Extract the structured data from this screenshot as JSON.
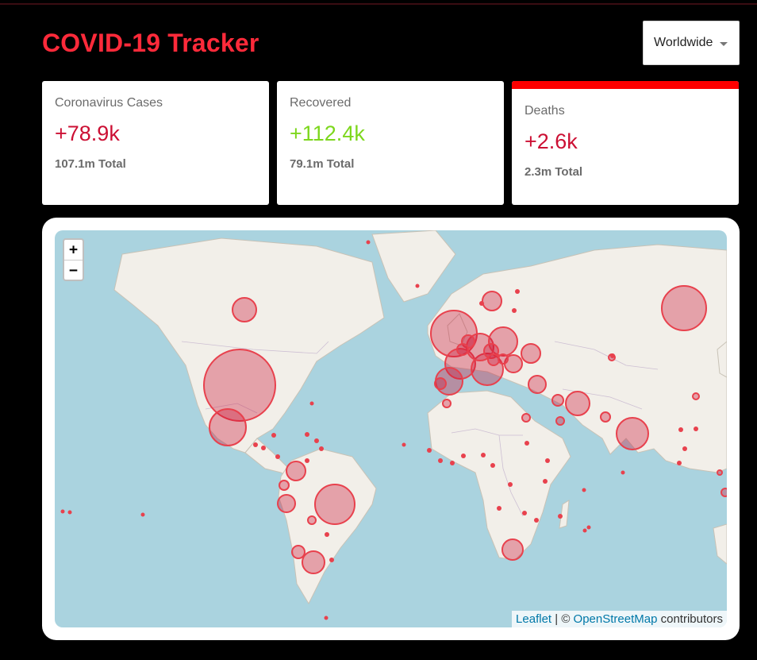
{
  "app": {
    "title": "COVID-19 Tracker"
  },
  "country_select": {
    "value": "Worldwide"
  },
  "cards": {
    "cases": {
      "label": "Coronavirus Cases",
      "today": "+78.9k",
      "total": "107.1m",
      "total_suffix": "Total"
    },
    "recovered": {
      "label": "Recovered",
      "today": "+112.4k",
      "total": "79.1m",
      "total_suffix": "Total"
    },
    "deaths": {
      "label": "Deaths",
      "today": "+2.6k",
      "total": "2.3m",
      "total_suffix": "Total"
    }
  },
  "map": {
    "zoom_in": "+",
    "zoom_out": "−",
    "attribution": {
      "leaflet": "Leaflet",
      "sep": " | © ",
      "osm": "OpenStreetMap",
      "suffix": " contributors"
    },
    "colors": {
      "water": "#aad3df",
      "land": "#f2efe9",
      "circle": "#cc1034",
      "accent": "#fe2a3a"
    }
  }
}
